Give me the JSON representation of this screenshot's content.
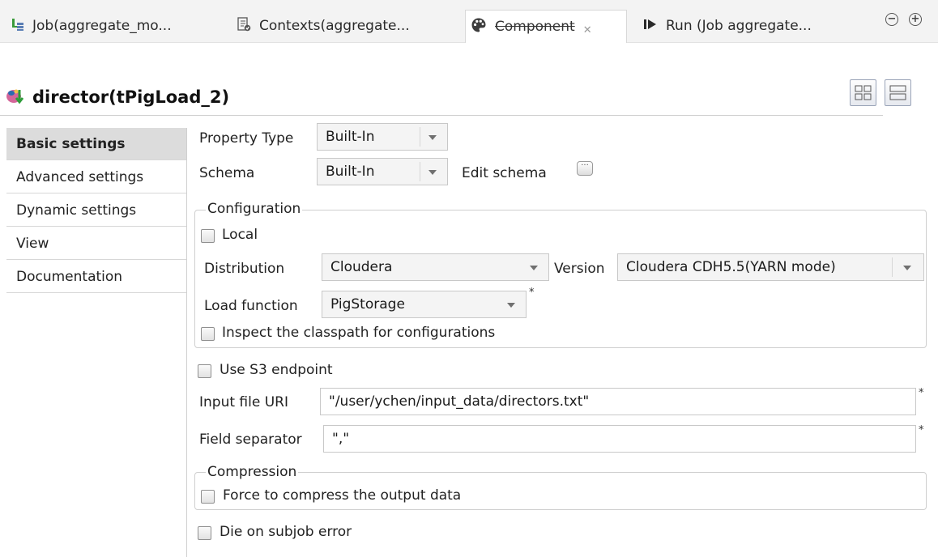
{
  "tabs": [
    {
      "label": "Job(aggregate_mo...",
      "icon": "job-icon"
    },
    {
      "label": "Contexts(aggregate...",
      "icon": "contexts-icon"
    },
    {
      "label": "Component",
      "icon": "palette-icon",
      "active": true
    },
    {
      "label": "Run (Job aggregate...",
      "icon": "run-icon"
    }
  ],
  "title": "director(tPigLoad_2)",
  "nav": [
    {
      "label": "Basic settings",
      "active": true
    },
    {
      "label": "Advanced settings"
    },
    {
      "label": "Dynamic settings"
    },
    {
      "label": "View"
    },
    {
      "label": "Documentation"
    }
  ],
  "form": {
    "property_type_label": "Property Type",
    "property_type_value": "Built-In",
    "schema_label": "Schema",
    "schema_value": "Built-In",
    "edit_schema_label": "Edit schema",
    "configuration": {
      "legend": "Configuration",
      "local_label": "Local",
      "local_checked": false,
      "distribution_label": "Distribution",
      "distribution_value": "Cloudera",
      "version_label": "Version",
      "version_value": "Cloudera CDH5.5(YARN mode)",
      "load_function_label": "Load function",
      "load_function_value": "PigStorage",
      "inspect_label": "Inspect the classpath for configurations",
      "inspect_checked": false
    },
    "use_s3_label": "Use S3 endpoint",
    "use_s3_checked": false,
    "input_uri_label": "Input file URI",
    "input_uri_value": "\"/user/ychen/input_data/directors.txt\"",
    "field_sep_label": "Field separator",
    "field_sep_value": "\",\"",
    "compression": {
      "legend": "Compression",
      "force_label": "Force to compress the output data",
      "force_checked": false
    },
    "die_label": "Die on subjob error",
    "die_checked": false,
    "required_mark": "*"
  },
  "colors": {
    "active_nav_bg": "#dcdcdc",
    "tab_bar_bg": "#f3f3f3"
  }
}
